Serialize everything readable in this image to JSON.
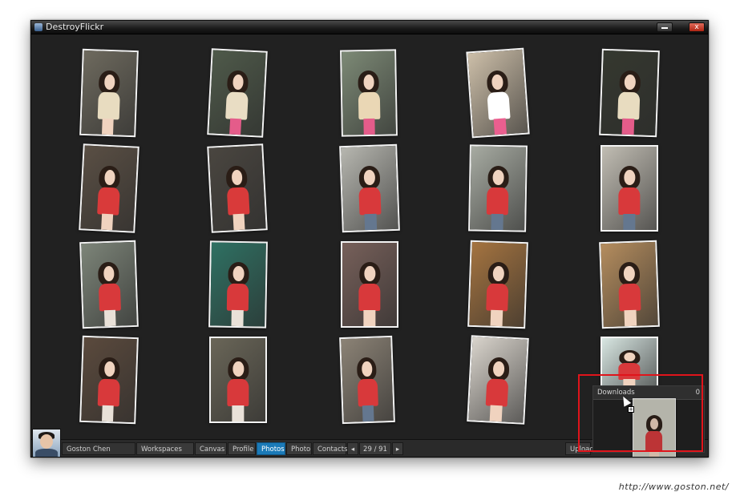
{
  "window": {
    "title": "DestroyFlickr",
    "minimize_icon": "minimize-icon",
    "close_label": "x"
  },
  "photos": [
    {
      "id": 1,
      "bg": "#6e6a5e",
      "body": "#e8dcc0",
      "legs": "#f0d3bf"
    },
    {
      "id": 2,
      "bg": "#4f5a4a",
      "body": "#e9ddc4",
      "legs": "#e45c8a"
    },
    {
      "id": 3,
      "bg": "#7d8a76",
      "body": "#ead7b5",
      "legs": "#e45c8a"
    },
    {
      "id": 4,
      "bg": "#cdbfa9",
      "body": "#ffffff",
      "legs": "#ea5f8f"
    },
    {
      "id": 5,
      "bg": "#35382f",
      "body": "#e8dcc0",
      "legs": "#e45c8a"
    },
    {
      "id": 6,
      "bg": "#5a4f44",
      "body": "#d93a3a",
      "legs": "#f0d3bf"
    },
    {
      "id": 7,
      "bg": "#4a4640",
      "body": "#d93a3a",
      "legs": "#f0d3bf"
    },
    {
      "id": 8,
      "bg": "#b7b7b0",
      "body": "#d8393b",
      "legs": "#64778f"
    },
    {
      "id": 9,
      "bg": "#a7aba2",
      "body": "#d8393b",
      "legs": "#64778f"
    },
    {
      "id": 10,
      "bg": "#c1bdb3",
      "body": "#d8393b",
      "legs": "#64778f"
    },
    {
      "id": 11,
      "bg": "#7d8579",
      "body": "#d8393b",
      "legs": "#e9e1d8"
    },
    {
      "id": 12,
      "bg": "#2f7163",
      "body": "#d8393b",
      "legs": "#e9e1d8"
    },
    {
      "id": 13,
      "bg": "#77605a",
      "body": "#d8393b",
      "legs": "#f0d3bf"
    },
    {
      "id": 14,
      "bg": "#a57440",
      "body": "#d8393b",
      "legs": "#f0d3bf"
    },
    {
      "id": 15,
      "bg": "#b58d5e",
      "body": "#d8393b",
      "legs": "#f0d3bf"
    },
    {
      "id": 16,
      "bg": "#5b4a3d",
      "body": "#d8393b",
      "legs": "#e9e1d8"
    },
    {
      "id": 17,
      "bg": "#6a6658",
      "body": "#d8393b",
      "legs": "#e9e1d8"
    },
    {
      "id": 18,
      "bg": "#8c8376",
      "body": "#d8393b",
      "legs": "#64778f"
    },
    {
      "id": 19,
      "bg": "#d9d4cc",
      "body": "#d8393b",
      "legs": "#f0d3bf"
    },
    {
      "id": 20,
      "bg": "#d8e6e2",
      "body": "#d8393b",
      "legs": "#f0d3bf"
    }
  ],
  "bottombar": {
    "avatar_icon": "user-avatar",
    "user_name": "Goston Chen",
    "workspaces": "Workspaces",
    "canvas": "Canvas",
    "profile": "Profile",
    "photos": "Photos",
    "photo": "Photo",
    "contacts": "Contacts",
    "prev_icon": "◂",
    "page": "29 / 91",
    "next_icon": "▸",
    "upload": "Upload"
  },
  "downloads": {
    "label": "Downloads",
    "count": "0"
  },
  "watermark": "http://www.goston.net/",
  "colors": {
    "accent": "#1b7ab8",
    "highlight": "#e0141b",
    "window_bg": "#212121"
  }
}
